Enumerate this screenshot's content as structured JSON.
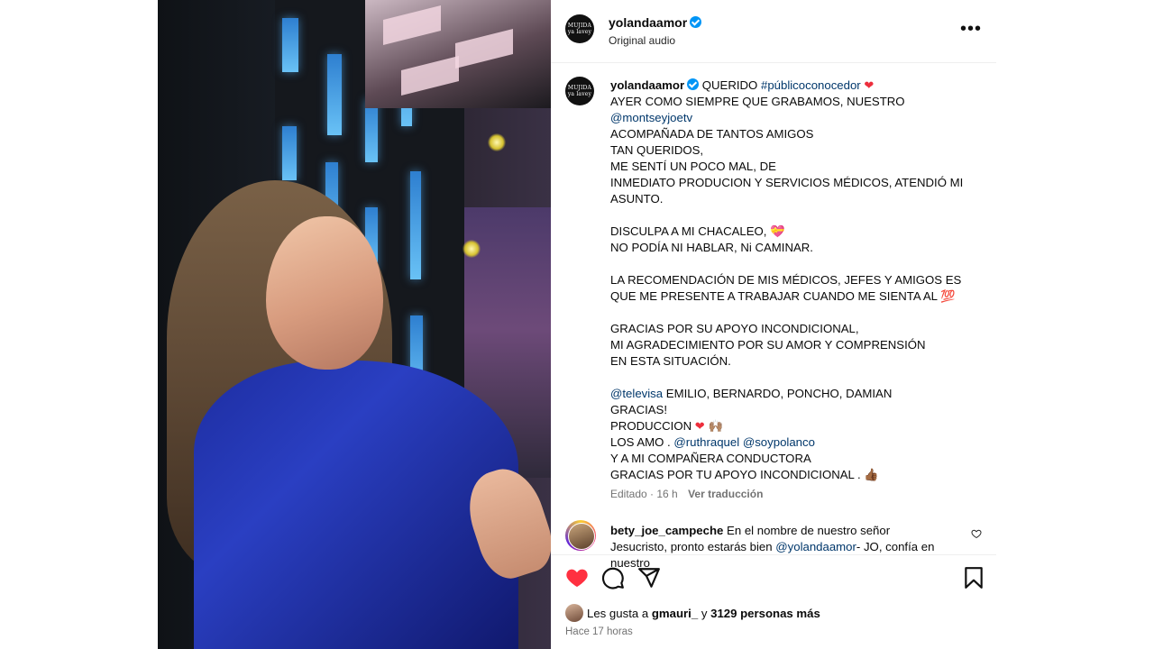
{
  "header": {
    "username": "yolandaamor",
    "audio": "Original audio",
    "avatar_text": [
      "MUJIDA",
      "ya lavey"
    ]
  },
  "caption": {
    "username": "yolandaamor",
    "first_line_text": "QUERIDO",
    "hashtag": "#públicoconocedor",
    "lines": {
      "l1": "AYER COMO SIEMPRE QUE GRABAMOS, NUESTRO",
      "mention_montsey": "@montseyjoetv",
      "l3": "ACOMPAÑADA DE TANTOS AMIGOS",
      "l4": "TAN QUERIDOS,",
      "l5": "ME SENTÍ UN POCO MAL, DE",
      "l6": "INMEDIATO PRODUCION Y SERVICIOS MÉDICOS, ATENDIÓ MI ASUNTO.",
      "l7": "DISCULPA A MI CHACALEO, 💝",
      "l8": "NO PODÍA NI HABLAR, Ni CAMINAR.",
      "l9": "LA RECOMENDACIÓN DE MIS MÉDICOS, JEFES Y AMIGOS ES",
      "l10": "QUE ME PRESENTE A TRABAJAR CUANDO ME SIENTA AL 💯",
      "l11": "GRACIAS POR SU APOYO INCONDICIONAL,",
      "l12": "MI AGRADECIMIENTO POR SU AMOR Y COMPRENSIÓN",
      "l13": "EN ESTA SITUACIÓN.",
      "mention_televisa": "@televisa",
      "l14": "EMILIO, BERNARDO, PONCHO, DAMIAN",
      "l15": "GRACIAS!",
      "l16": "PRODUCCION",
      "l16_emoji": "🙌🏽",
      "l17": "LOS AMO .",
      "mention_ruth": "@ruthraquel",
      "mention_soy": "@soypolanco",
      "l18": "Y A MI COMPAÑERA CONDUCTORA",
      "l19": "GRACIAS POR TU APOYO INCONDICIONAL .",
      "l19_emoji": "👍🏾"
    }
  },
  "meta": {
    "edited": "Editado · 16 h",
    "translate": "Ver traducción"
  },
  "comment": {
    "username": "bety_joe_campeche",
    "text1": "En el nombre de nuestro señor Jesucristo, pronto estarás bien",
    "mention": "@yolandaamor",
    "text2": "- JO, confía en nuestro"
  },
  "likes": {
    "prefix": "Les gusta a",
    "user": "gmauri_",
    "and": "y",
    "others": "3129 personas más"
  },
  "time": "Hace 17 horas",
  "colors": {
    "verified": "#0095f6",
    "link": "#00376b",
    "like_red": "#ed2e3c",
    "muted": "#737373"
  },
  "icons": [
    "verified-badge-icon",
    "more-options-icon",
    "heart-icon",
    "comment-icon",
    "share-icon",
    "bookmark-icon",
    "small-heart-icon"
  ]
}
